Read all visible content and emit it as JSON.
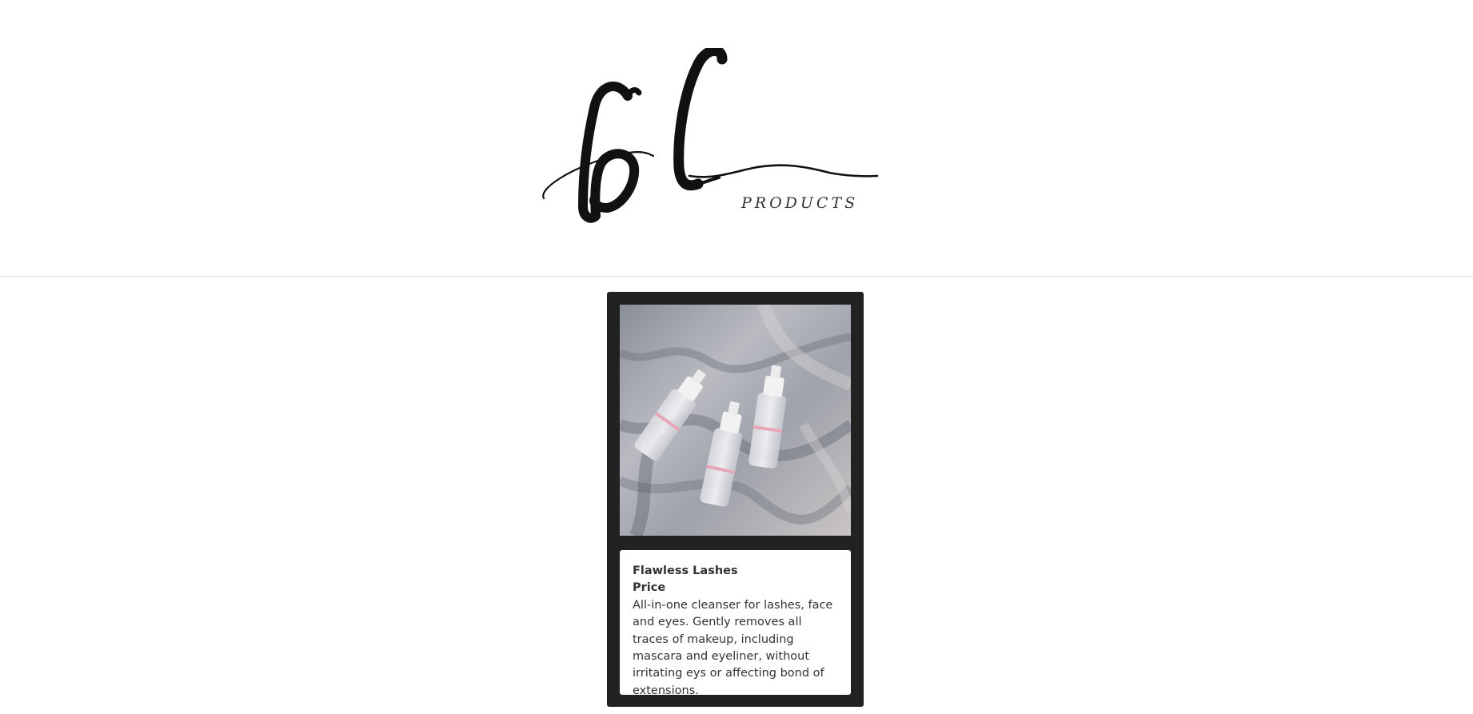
{
  "header": {
    "logo": {
      "mark": "bl",
      "subtitle": "PRODUCTS"
    }
  },
  "product": {
    "image_alt": "Three foaming cleanser bottles on grey fabric",
    "title": "Flawless Lashes",
    "price_label": "Price",
    "description": "All-in-one cleanser for lashes, face and eyes. Gently removes all traces of makeup, including mascara and eyeliner, without irritating eys or affecting bond of extensions."
  },
  "colors": {
    "card_background": "#222222",
    "text": "#333333",
    "divider": "#e3e3e3"
  }
}
